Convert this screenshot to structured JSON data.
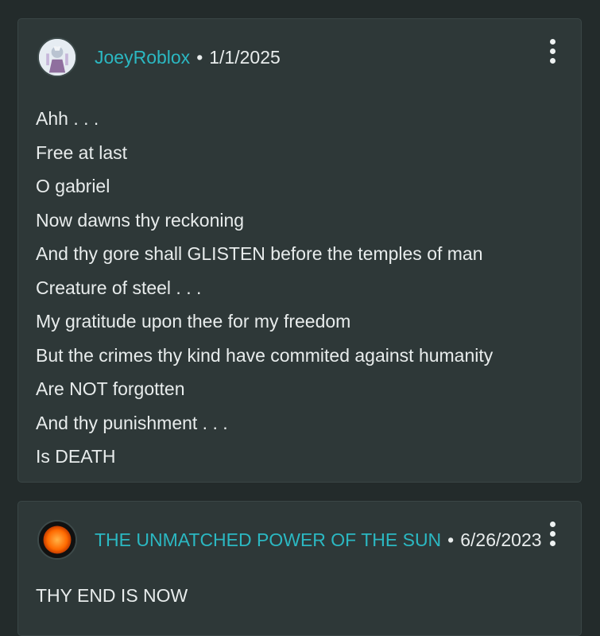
{
  "comments": [
    {
      "author": "JoeyRoblox",
      "separator": "•",
      "date": "1/1/2025",
      "avatar_icon": "user-avatar-icon",
      "menu_icon": "more-vertical-icon",
      "lines": [
        "Ahh . . .",
        "Free at last",
        "O gabriel",
        "Now dawns thy reckoning",
        "And thy gore shall GLISTEN before the temples of man",
        "Creature of steel . . .",
        "My gratitude upon thee for my freedom",
        "But the crimes thy kind have commited against humanity",
        "Are NOT forgotten",
        "And thy punishment . . .",
        "Is DEATH"
      ]
    },
    {
      "author": "THE UNMATCHED POWER OF THE SUN",
      "separator": "•",
      "date": "6/26/2023",
      "avatar_icon": "sun-avatar-icon",
      "menu_icon": "more-vertical-icon",
      "text": "THY END IS NOW"
    }
  ],
  "colors": {
    "background": "#232b2b",
    "card": "#2e3838",
    "author": "#2bb8c2",
    "text": "#e8ecec"
  }
}
